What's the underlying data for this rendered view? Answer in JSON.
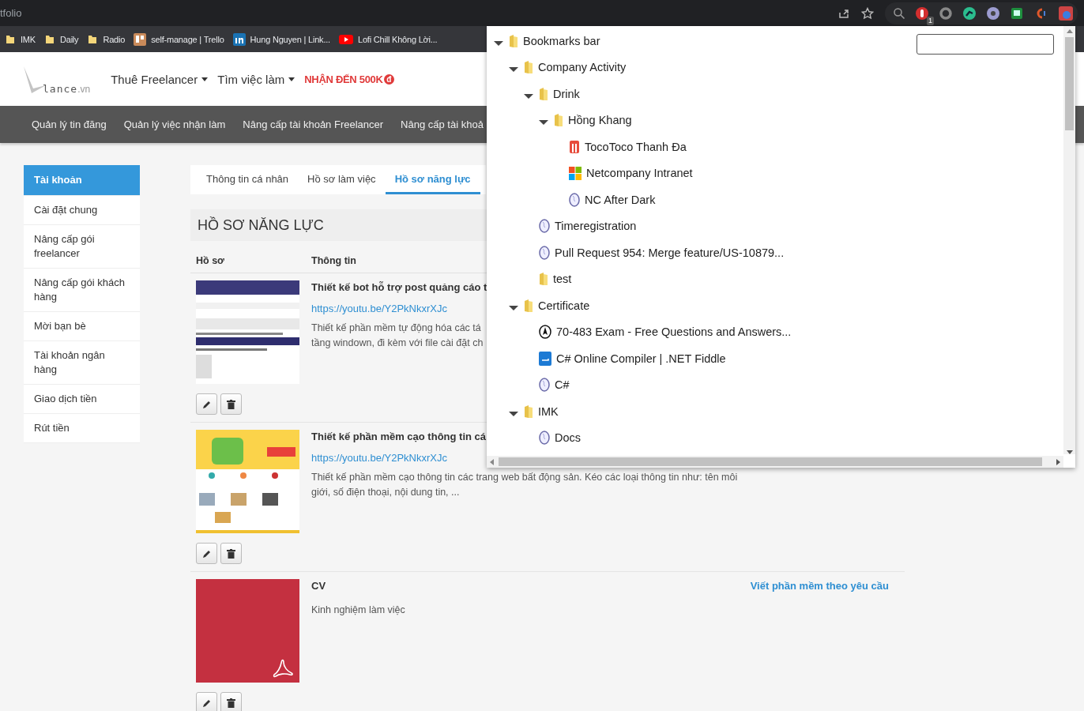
{
  "browser": {
    "tab_title": "tfolio",
    "extension_badge": "1",
    "bookmarks": [
      {
        "label": "IMK",
        "kind": "folder"
      },
      {
        "label": "Daily",
        "kind": "folder"
      },
      {
        "label": "Radio",
        "kind": "folder"
      },
      {
        "label": "self-manage | Trello",
        "kind": "board"
      },
      {
        "label": "Hung Nguyen | Link...",
        "kind": "linkedin"
      },
      {
        "label": "Lofi Chill Không Lời...",
        "kind": "video"
      }
    ]
  },
  "site": {
    "logo": {
      "name": "lance",
      "tld": ".vn"
    },
    "nav": [
      {
        "label": "Thuê Freelancer",
        "dropdown": true
      },
      {
        "label": "Tìm việc làm",
        "dropdown": true
      }
    ],
    "promo": {
      "text": "NHẬN ĐẾN 500K",
      "currency": "đ"
    },
    "menu": [
      "Quản lý tin đăng",
      "Quản lý việc nhận làm",
      "Nâng cấp tài khoản Freelancer",
      "Nâng cấp tài khoả"
    ]
  },
  "sidebar": {
    "items": [
      {
        "label": "Tài khoản",
        "selected": true
      },
      {
        "label": "Cài đặt chung",
        "selected": false
      },
      {
        "label": "Nâng cấp gói freelancer",
        "selected": false
      },
      {
        "label": "Nâng cấp gói khách hàng",
        "selected": false
      },
      {
        "label": "Mời bạn bè",
        "selected": false
      },
      {
        "label": "Tài khoản ngân hàng",
        "selected": false
      },
      {
        "label": "Giao dịch tiền",
        "selected": false
      },
      {
        "label": "Rút tiền",
        "selected": false
      }
    ]
  },
  "tabs": [
    {
      "label": "Thông tin cá nhân",
      "selected": false
    },
    {
      "label": "Hồ sơ làm việc",
      "selected": false
    },
    {
      "label": "Hồ sơ năng lực",
      "selected": true
    }
  ],
  "section_title": "HỒ SƠ NĂNG LỰC",
  "table": {
    "columns": [
      "Hồ sơ",
      "Thông tin"
    ],
    "rows": [
      {
        "thumb": {
          "kind": "picture"
        },
        "title": "Thiết kế bot hỗ trợ post quảng cáo t",
        "link": "https://youtu.be/Y2PkNkxrXJc",
        "description": [
          "Thiết kế phần mềm tự động hóa các tá",
          "tầng windown, đi kèm với file cài đặt ch"
        ]
      },
      {
        "thumb": {
          "kind": "picture"
        },
        "title": "Thiết kế phần mềm cạo thông tin cá",
        "link": "https://youtu.be/Y2PkNkxrXJc",
        "description": [
          "Thiết kế phần mềm cạo thông tin các trang web bất động sản. Kéo các loại thông tin như: tên môi giới, số điện thoại, nội dung tin, ..."
        ]
      },
      {
        "thumb": {
          "kind": "pdf"
        },
        "title": "CV",
        "description": [
          "Kinh nghiệm làm việc"
        ],
        "category": "Viết phần mềm theo yêu cầu"
      }
    ]
  },
  "bookmark_manager": {
    "tree": [
      {
        "label": "Bookmarks bar",
        "kind": "folder",
        "expanded": true,
        "children": [
          {
            "label": "Company Activity",
            "kind": "folder",
            "expanded": true,
            "children": [
              {
                "label": "Drink",
                "kind": "folder",
                "expanded": true,
                "children": [
                  {
                    "label": "Hồng Khang",
                    "kind": "folder",
                    "expanded": true,
                    "children": [
                      {
                        "label": "TocoToco Thanh Đa",
                        "kind": "cup"
                      },
                      {
                        "label": "Netcompany Intranet",
                        "kind": "windows"
                      },
                      {
                        "label": "NC After Dark",
                        "kind": "globe"
                      }
                    ]
                  }
                ]
              },
              {
                "label": "Timeregistration",
                "kind": "globe"
              },
              {
                "label": "Pull Request 954: Merge feature/US-10879...",
                "kind": "globe"
              },
              {
                "label": "test",
                "kind": "folder"
              }
            ]
          },
          {
            "label": "Certificate",
            "kind": "folder",
            "expanded": true,
            "children": [
              {
                "label": "70-483 Exam - Free Questions and Answers...",
                "kind": "compass"
              },
              {
                "label": "C# Online Compiler | .NET Fiddle",
                "kind": "fiddle"
              },
              {
                "label": "C#",
                "kind": "globe"
              }
            ]
          },
          {
            "label": "IMK",
            "kind": "folder",
            "expanded": true,
            "children": [
              {
                "label": "Docs",
                "kind": "globe"
              }
            ]
          }
        ]
      }
    ]
  }
}
